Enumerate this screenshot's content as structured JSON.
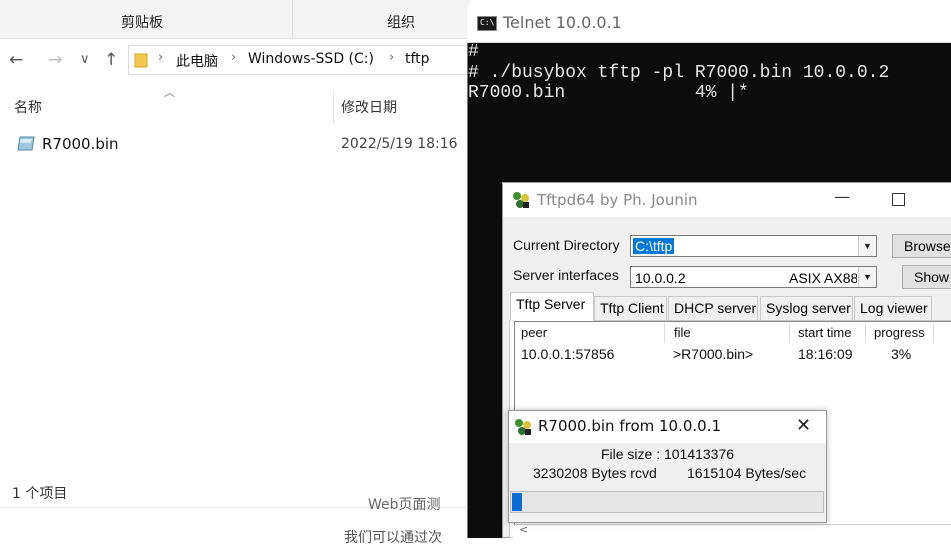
{
  "explorer": {
    "ribbon": {
      "clipboard": "剪贴板",
      "organize": "组织"
    },
    "nav": {
      "back": "←",
      "forward": "→",
      "recent": "∨",
      "up": "↑"
    },
    "breadcrumb": [
      "此电脑",
      "Windows-SSD (C:)",
      "tftp"
    ],
    "columns": {
      "name": "名称",
      "date": "修改日期"
    },
    "files": [
      {
        "name": "R7000.bin",
        "date": "2022/5/19 18:16"
      }
    ],
    "status": "1 个项目",
    "background_text_1": "Web页面测",
    "background_text_2": "我们可以通过次"
  },
  "telnet": {
    "title": "Telnet 10.0.0.1",
    "lines": [
      "#",
      "# ./busybox tftp -pl R7000.bin 10.0.0.2",
      "R7000.bin            4% |*"
    ]
  },
  "tftpd": {
    "title": "Tftpd64 by Ph. Jounin",
    "current_directory_label": "Current Directory",
    "current_directory_value": "C:\\tftp",
    "server_interfaces_label": "Server interfaces",
    "server_interface_ip": "10.0.0.2",
    "server_interface_adapter": "ASIX AX88",
    "browse_label": "Browse",
    "show_label": "Show Dir",
    "tabs": [
      "Tftp Server",
      "Tftp Client",
      "DHCP server",
      "Syslog server",
      "Log viewer"
    ],
    "active_tab": "Tftp Server",
    "table": {
      "headers": [
        "peer",
        "file",
        "start time",
        "progress"
      ],
      "rows": [
        {
          "peer": "10.0.0.1:57856",
          "file": ">R7000.bin>",
          "start_time": "18:16:09",
          "progress": "3%"
        }
      ]
    }
  },
  "transfer": {
    "title": "R7000.bin from 10.0.0.1",
    "file_size": "File size : 101413376",
    "bytes_rcvd": "3230208 Bytes rcvd",
    "rate": "1615104 Bytes/sec",
    "progress_fraction": 0.032
  },
  "colors": {
    "selection": "#0078d7",
    "progress": "#0a6cd4",
    "terminal_bg": "#0c0c0c"
  },
  "icons": {
    "folder": "folder-icon",
    "file": "bin-file-icon",
    "app": "tftpd-app-icon"
  }
}
